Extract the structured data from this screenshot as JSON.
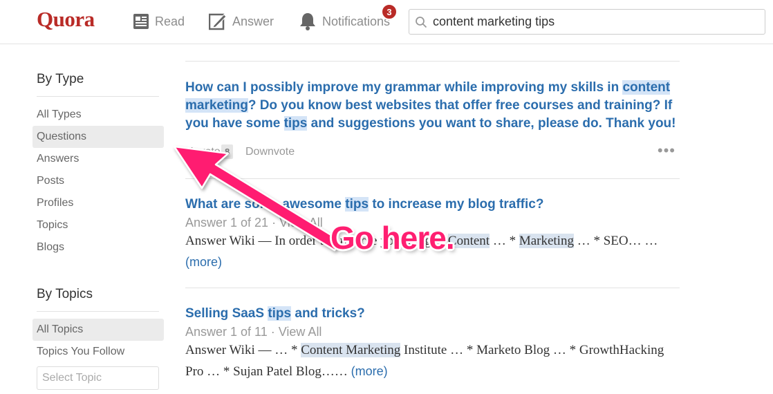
{
  "header": {
    "logo": "Quora",
    "nav": {
      "read": "Read",
      "answer": "Answer",
      "notifications": "Notifications"
    },
    "notification_count": "3",
    "search_value": "content marketing tips"
  },
  "sidebar": {
    "by_type_heading": "By Type",
    "type_items": [
      "All Types",
      "Questions",
      "Answers",
      "Posts",
      "Profiles",
      "Topics",
      "Blogs"
    ],
    "selected_type": "Questions",
    "by_topics_heading": "By Topics",
    "topic_items": [
      "All Topics",
      "Topics You Follow"
    ],
    "selected_topic": "All Topics",
    "select_topic_placeholder": "Select Topic"
  },
  "results": [
    {
      "title_parts": [
        "How can I possibly improve my grammar while improving my skills in ",
        "content",
        " ",
        "marketing",
        "? Do you know best websites that offer free courses and training? If you have some ",
        "tips",
        " and suggestions you want to share, please do. Thank you!"
      ],
      "upvote_label": "Upvote",
      "upvote_count": "8",
      "downvote_label": "Downvote",
      "more_actions": "•••"
    },
    {
      "title_parts": [
        "What are some awesome ",
        "tips",
        " to increase my blog traffic?"
      ],
      "answer_count": "Answer 1 of 21",
      "separator": "·",
      "view_all": "View All",
      "snippet_parts": [
        "Answer Wiki — In order to promote your blog: * ",
        "Content",
        " …  * ",
        "Marketing",
        " …  * SEO… …"
      ],
      "more_label": "(more)"
    },
    {
      "title_parts": [
        "Selling SaaS ",
        "tips",
        " and tricks?"
      ],
      "answer_count": "Answer 1 of 11",
      "separator": "·",
      "view_all": "View All",
      "snippet_parts": [
        "Answer Wiki —  …  * ",
        "Content Marketing",
        " Institute …  * Marketo Blog …  * GrowthHacking Pro …  * Sujan Patel Blog……"
      ],
      "more_label": "(more)"
    }
  ],
  "annotation": {
    "text": "Go here.",
    "color": "#ff1f71"
  },
  "colors": {
    "brand": "#b92b27",
    "link": "#2b6dad",
    "highlight": "#d4e4f7"
  }
}
